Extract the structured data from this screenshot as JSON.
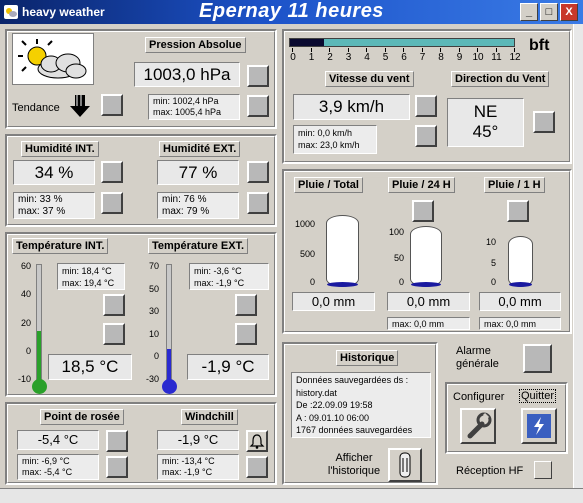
{
  "window": {
    "app_title": "heavy weather",
    "title": "Epernay 11 heures",
    "minimize": "_",
    "maximize": "□",
    "close": "X"
  },
  "wind_scale": {
    "unit": "bft",
    "ticks": [
      "0",
      "1",
      "2",
      "3",
      "4",
      "5",
      "6",
      "7",
      "8",
      "9",
      "10",
      "11",
      "12"
    ],
    "level": 0.15
  },
  "pressure": {
    "header": "Pression Absolue",
    "value": "1003,0 hPa",
    "min": "min: 1002,4 hPa",
    "max": "max: 1005,4 hPa",
    "trend_label": "Tendance"
  },
  "wind_speed": {
    "header": "Vitesse du vent",
    "value": "3,9 km/h",
    "min": "min: 0,0 km/h",
    "max": "max: 23,0 km/h"
  },
  "wind_dir": {
    "header": "Direction du Vent",
    "dir": "NE",
    "deg": "45°"
  },
  "hum_int": {
    "header": "Humidité INT.",
    "value": "34 %",
    "min": "min: 33 %",
    "max": "max: 37 %"
  },
  "hum_ext": {
    "header": "Humidité EXT.",
    "value": "77 %",
    "min": "min: 76 %",
    "max": "max: 79 %"
  },
  "temp_int": {
    "header": "Température INT.",
    "value": "18,5 °C",
    "min": "min: 18,4 °C",
    "max": "max: 19,4 °C",
    "ticks": [
      "60",
      "40",
      "20",
      "0",
      "-10"
    ]
  },
  "temp_ext": {
    "header": "Température EXT.",
    "value": "-1,9 °C",
    "min": "min: -3,6 °C",
    "max": "max: -1,9 °C",
    "ticks": [
      "70",
      "50",
      "30",
      "10",
      "0",
      "-30"
    ]
  },
  "rain": {
    "total": {
      "header": "Pluie / Total",
      "value": "0,0 mm",
      "ticks": [
        "1000",
        "500",
        "0"
      ]
    },
    "h24": {
      "header": "Pluie / 24 H",
      "value": "0,0 mm",
      "ticks": [
        "100",
        "50",
        "0"
      ],
      "max": "max: 0,0 mm"
    },
    "h1": {
      "header": "Pluie / 1 H",
      "value": "0,0 mm",
      "ticks": [
        "10",
        "5",
        "0"
      ],
      "max": "max: 0,0 mm"
    }
  },
  "dew": {
    "header": "Point de rosée",
    "value": "-5,4 °C",
    "min": "min: -6,9 °C",
    "max": "max: -5,4 °C"
  },
  "windchill": {
    "header": "Windchill",
    "value": "-1,9 °C",
    "min": "min: -13,4 °C",
    "max": "max: -1,9 °C"
  },
  "history": {
    "header": "Historique",
    "lines": [
      "Données sauvegardées ds :",
      "history.dat",
      "De :22.09.09 19:58",
      "A  : 09.01.10 06:00",
      "1767 données sauvegardées"
    ],
    "show_label_1": "Afficher",
    "show_label_2": "l'historique"
  },
  "alarm": {
    "label_1": "Alarme",
    "label_2": "générale"
  },
  "config": {
    "configure": "Configurer",
    "quit": "Quitter"
  },
  "hf": {
    "label": "Réception HF"
  },
  "colors": {
    "title_start": "#0a246a",
    "title_end": "#3a7be6",
    "wind_bar": "#5cb8b8",
    "temp_int_fill": "#2aa02a",
    "temp_ext_fill": "#2a2ad0",
    "rain_fill": "#1a1aa0"
  }
}
